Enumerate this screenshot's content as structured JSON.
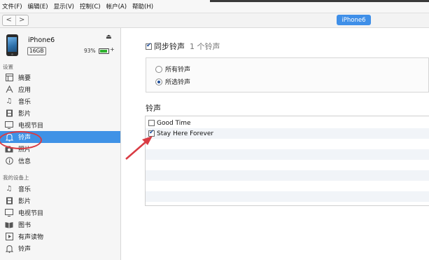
{
  "menu": {
    "items": [
      "文件(F)",
      "编辑(E)",
      "显示(V)",
      "控制(C)",
      "帐户(A)",
      "帮助(H)"
    ]
  },
  "toolbar": {
    "back_icon": "<",
    "forward_icon": ">",
    "device_button": "iPhone6"
  },
  "device": {
    "name": "iPhone6",
    "eject_icon": "⏏",
    "capacity": "16GB",
    "battery_percent": "93%",
    "battery_level": 0.93,
    "battery_charging_icon": "+"
  },
  "sidebar": {
    "settings_title": "设置",
    "settings_items": [
      {
        "label": "摘要",
        "icon": "summary-icon"
      },
      {
        "label": "应用",
        "icon": "apps-icon"
      },
      {
        "label": "音乐",
        "icon": "music-icon"
      },
      {
        "label": "影片",
        "icon": "film-icon"
      },
      {
        "label": "电视节目",
        "icon": "tv-icon"
      },
      {
        "label": "铃声",
        "icon": "bell-icon",
        "selected": true
      },
      {
        "label": "照片",
        "icon": "camera-icon"
      },
      {
        "label": "信息",
        "icon": "info-icon"
      }
    ],
    "ondevice_title": "我的设备上",
    "ondevice_items": [
      {
        "label": "音乐",
        "icon": "music-icon"
      },
      {
        "label": "影片",
        "icon": "film-icon"
      },
      {
        "label": "电视节目",
        "icon": "tv-icon"
      },
      {
        "label": "图书",
        "icon": "book-icon"
      },
      {
        "label": "有声读物",
        "icon": "audiobook-icon"
      },
      {
        "label": "铃声",
        "icon": "bell-icon"
      }
    ]
  },
  "main": {
    "sync_label": "同步铃声",
    "sync_count": "1 个铃声",
    "sync_checked": true,
    "options": [
      {
        "label": "所有铃声",
        "selected": false
      },
      {
        "label": "所选铃声",
        "selected": true
      }
    ],
    "list_title": "铃声",
    "ringtones": [
      {
        "label": "Good Time",
        "checked": false
      },
      {
        "label": "Stay Here Forever",
        "checked": true
      }
    ]
  },
  "colors": {
    "selection_blue": "#3f92e6",
    "annotation_red": "#d93b43"
  }
}
